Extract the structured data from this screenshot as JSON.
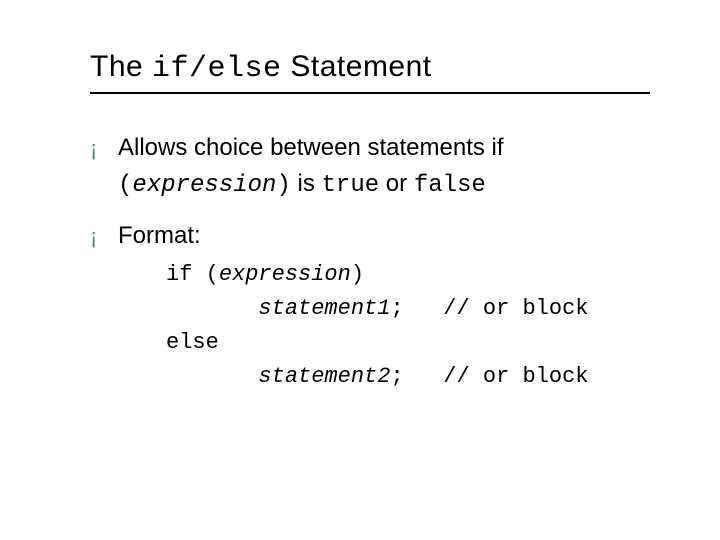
{
  "title": {
    "pre": "The ",
    "code": "if/else",
    "post": " Statement"
  },
  "bullets": [
    {
      "pre": "Allows choice between statements if ",
      "code1": "(",
      "ital": "expression",
      "code1b": ")",
      "mid": " is ",
      "code2": "true",
      "mid2": " or ",
      "code3": "false"
    },
    {
      "label": "Format:"
    }
  ],
  "code": {
    "l1a": "if (",
    "l1b": "expression",
    "l1c": ")",
    "l2a": "       ",
    "l2b": "statement1",
    "l2c": ";   // or block",
    "l3": "else",
    "l4a": "       ",
    "l4b": "statement2",
    "l4c": ";   // or block"
  }
}
